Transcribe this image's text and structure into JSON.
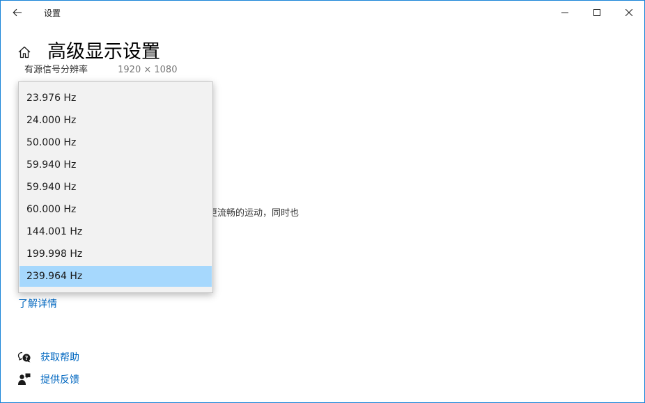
{
  "window": {
    "title": "设置"
  },
  "header": {
    "title": "高级显示设置"
  },
  "background": {
    "resolution_label": "有源信号分辨率",
    "resolution_value": "1920 × 1080",
    "refresh_description_fragment": "获更流畅的运动，同时也",
    "learn_more": "了解详情"
  },
  "dropdown": {
    "options": [
      "23.976 Hz",
      "24.000 Hz",
      "50.000 Hz",
      "59.940 Hz",
      "59.940 Hz",
      "60.000 Hz",
      "144.001 Hz",
      "199.998 Hz",
      "239.964 Hz"
    ],
    "selected_value": "239.964 Hz"
  },
  "help": {
    "get_help": "获取帮助",
    "feedback": "提供反馈"
  },
  "icons": {
    "back": "back-arrow-icon",
    "home": "home-icon",
    "minimize": "minimize-icon",
    "maximize": "maximize-icon",
    "close": "close-icon",
    "get_help": "chat-help-icon",
    "feedback": "feedback-person-icon"
  },
  "colors": {
    "accent_border": "#1883d7",
    "link": "#0067c0",
    "selected_option": "#a6d8fd",
    "dropdown_bg": "#f2f2f2"
  }
}
